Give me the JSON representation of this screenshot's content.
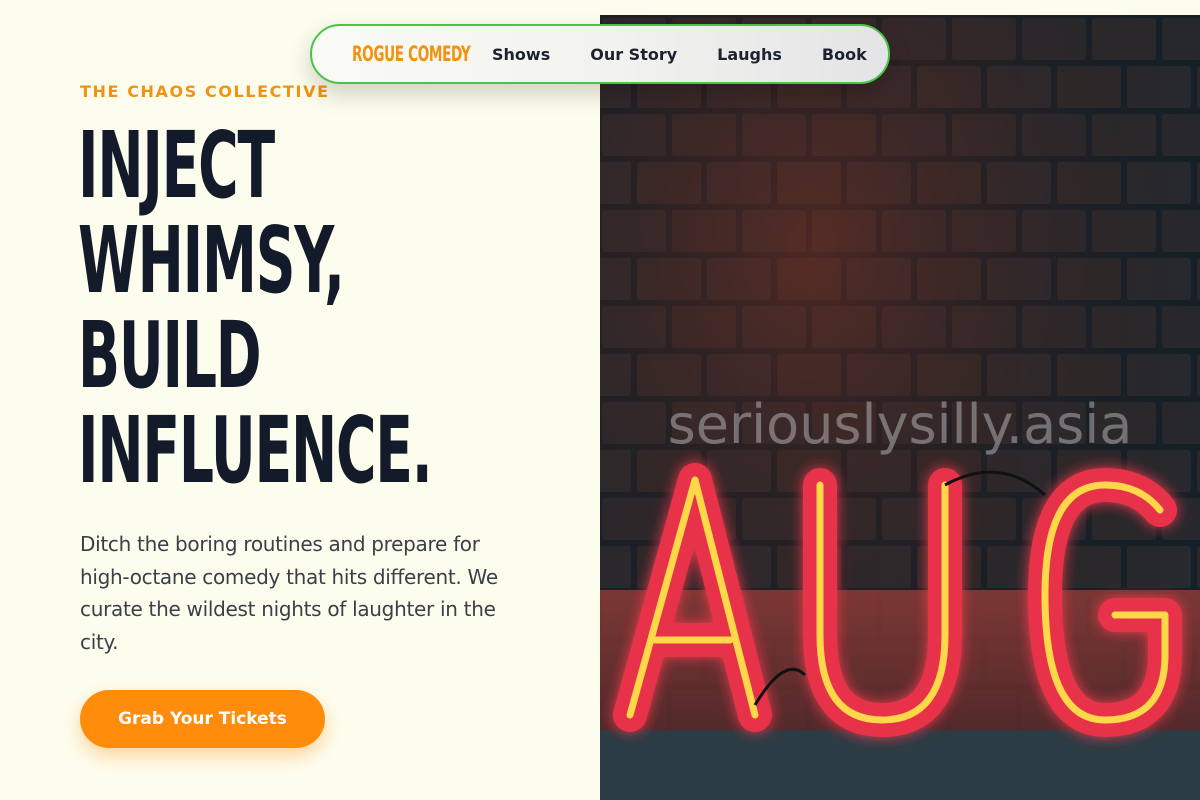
{
  "nav": {
    "brand": "ROGUE COMEDY",
    "links": [
      "Shows",
      "Our Story",
      "Laughs",
      "Book"
    ]
  },
  "hero": {
    "eyebrow": "THE CHAOS COLLECTIVE",
    "headline_lines": [
      "INJECT",
      "WHIMSY,",
      "BUILD",
      "INFLUENCE."
    ],
    "description": "Ditch the boring routines and prepare for high-octane comedy that hits different. We curate the wildest nights of laughter in the city.",
    "cta_label": "Grab Your Tickets"
  },
  "image": {
    "watermark": "seriouslysilly.asia",
    "neon_sign": "AUG",
    "subject": "neon-sign-on-brick-wall"
  },
  "colors": {
    "background": "#fdfdee",
    "accent": "#f39212",
    "cta": "#ff8c0a",
    "headline": "#131a2a",
    "nav_border": "#4cc24a",
    "neon_red": "#e8304a",
    "neon_yellow": "#ffd84a"
  }
}
